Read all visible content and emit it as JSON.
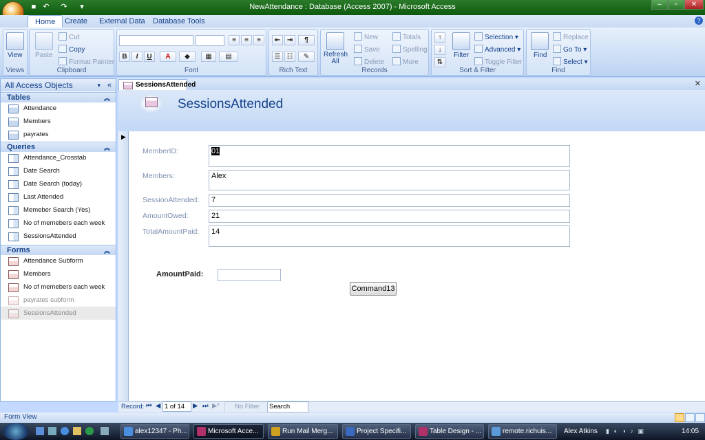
{
  "window": {
    "title": "NewAttendance : Database (Access 2007) - Microsoft Access"
  },
  "ribbon_tabs": [
    "Home",
    "Create",
    "External Data",
    "Database Tools"
  ],
  "ribbon": {
    "views": {
      "view_label": "View",
      "group_label": "Views"
    },
    "clipboard": {
      "paste": "Paste",
      "cut": "Cut",
      "copy": "Copy",
      "format_painter": "Format Painter",
      "group_label": "Clipboard"
    },
    "font": {
      "group_label": "Font"
    },
    "rich_text": {
      "group_label": "Rich Text"
    },
    "records": {
      "refresh": "Refresh All",
      "new": "New",
      "save": "Save",
      "delete": "Delete",
      "totals": "Totals",
      "spelling": "Spelling",
      "more": "More",
      "group_label": "Records"
    },
    "sort_filter": {
      "filter": "Filter",
      "selection": "Selection",
      "advanced": "Advanced",
      "toggle_filter": "Toggle Filter",
      "group_label": "Sort & Filter"
    },
    "find": {
      "find": "Find",
      "replace": "Replace",
      "go_to": "Go To",
      "select": "Select",
      "group_label": "Find"
    }
  },
  "nav_pane": {
    "header": "All Access Objects",
    "sections": [
      {
        "title": "Tables",
        "items": [
          "Attendance",
          "Members",
          "payrates"
        ]
      },
      {
        "title": "Queries",
        "items": [
          "Attendance_Crosstab",
          "Date Search",
          "Date Search (today)",
          "Last Attended",
          "Memeber Search (Yes)",
          "No of memebers each week",
          "SessionsAttended"
        ]
      },
      {
        "title": "Forms",
        "items": [
          "Attendance Subform",
          "Members",
          "No of memebers each week",
          "payrates subform",
          "SessionsAttended"
        ]
      }
    ]
  },
  "document": {
    "tab_label": "SessionsAttended",
    "form_title": "SessionsAttended",
    "fields": [
      {
        "label": "MemberID:",
        "value": "01"
      },
      {
        "label": "Members:",
        "value": "Alex"
      },
      {
        "label": "SessionAttended:",
        "value": "7"
      },
      {
        "label": "AmountOwed:",
        "value": "21"
      },
      {
        "label": "TotalAmountPaid:",
        "value": "14"
      }
    ],
    "amount_paid_label": "AmountPaid:",
    "amount_paid_value": "",
    "command_label": "Command13"
  },
  "record_nav": {
    "record_label": "Record:",
    "position": "1 of 14",
    "filter": "No Filter",
    "search": "Search"
  },
  "status": {
    "text": "Form View"
  },
  "taskbar": {
    "tasks": [
      "alex12347 - Ph...",
      "Microsoft Acce...",
      "Run Mail Merg...",
      "Project Specifi...",
      "Table Design - ...",
      "remote.richuis..."
    ],
    "user": "Alex Atkins",
    "clock": "14:05"
  },
  "colors": {
    "accent": "#15428b",
    "title_bar": "#0e5a0e",
    "ribbon": "#c9dcf5"
  }
}
